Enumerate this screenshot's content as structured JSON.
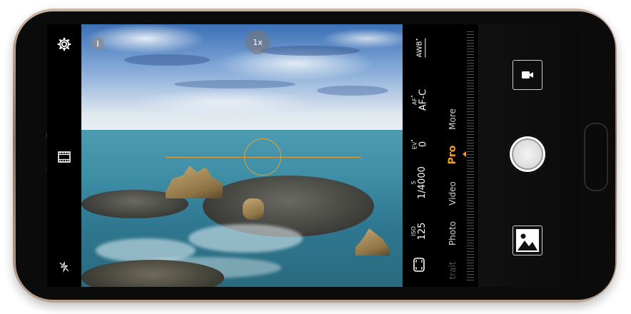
{
  "camera": {
    "zoom_label": "1x",
    "info_glyph": "i",
    "mode": "Pro",
    "icons": {
      "settings": "gear-icon",
      "filter": "film-strip-icon",
      "flash": "flash-off-icon",
      "info": "info-icon",
      "aspect": "aspect-ratio-icon",
      "video": "video-camera-icon",
      "shutter": "shutter-icon",
      "gallery": "gallery-thumbnail-icon"
    },
    "accent_color": "#f0a030"
  },
  "pro_params": [
    {
      "label": "AWB",
      "value": "",
      "sup": "•"
    },
    {
      "label": "AF",
      "value": "AF-C",
      "sup": "•"
    },
    {
      "label": "EV",
      "value": "0",
      "sup": "•"
    },
    {
      "label": "S",
      "value": "1/4000",
      "sup": ""
    },
    {
      "label": "ISO",
      "value": "125",
      "sup": ""
    }
  ],
  "modes": [
    {
      "label": "More"
    },
    {
      "label": "Pro"
    },
    {
      "label": "Video"
    },
    {
      "label": "Photo"
    },
    {
      "label": "trait"
    }
  ]
}
